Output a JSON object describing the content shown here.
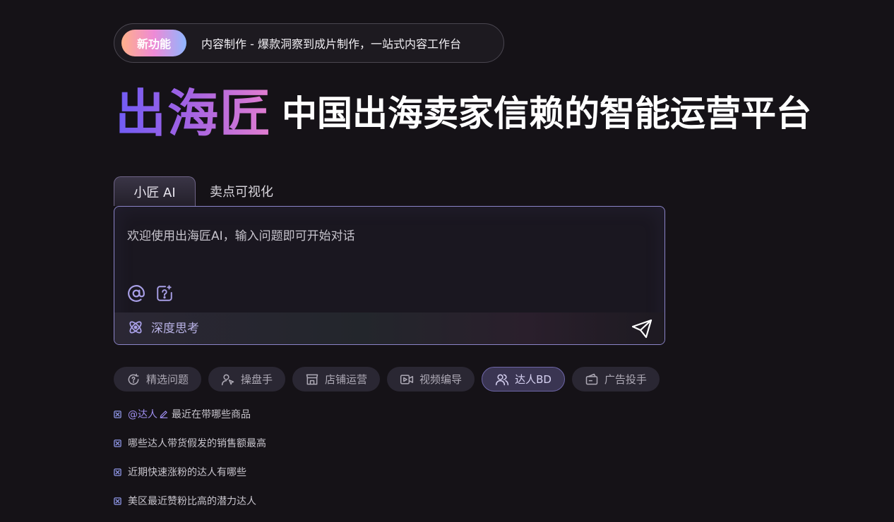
{
  "announcement": {
    "badge": "新功能",
    "text": "内容制作 - 爆款洞察到成片制作，一站式内容工作台"
  },
  "hero": {
    "brand": "出海匠",
    "tagline": "中国出海卖家信赖的智能运营平台"
  },
  "tabs": [
    {
      "label": "小匠 AI",
      "active": true
    },
    {
      "label": "卖点可视化",
      "active": false
    }
  ],
  "chat": {
    "placeholder": "欢迎使用出海匠AI，输入问题即可开始对话",
    "deep_think_label": "深度思考"
  },
  "chips": [
    {
      "label": "精选问题",
      "icon": "question-refresh-icon"
    },
    {
      "label": "操盘手",
      "icon": "user-pointer-icon"
    },
    {
      "label": "店铺运营",
      "icon": "store-icon"
    },
    {
      "label": "视频编导",
      "icon": "video-icon"
    },
    {
      "label": "达人BD",
      "icon": "users-icon",
      "active": true
    },
    {
      "label": "广告投手",
      "icon": "ad-card-icon"
    }
  ],
  "suggestions": {
    "first_mention": "@达人",
    "first_text": "最近在带哪些商品",
    "items": [
      "哪些达人带货假发的销售额最高",
      "近期快速涨粉的达人有哪些",
      "美区最近赞粉比高的潜力达人"
    ]
  },
  "colors": {
    "background": "#151217",
    "accent": "#8b84c8",
    "mention": "#9f8ff0"
  }
}
